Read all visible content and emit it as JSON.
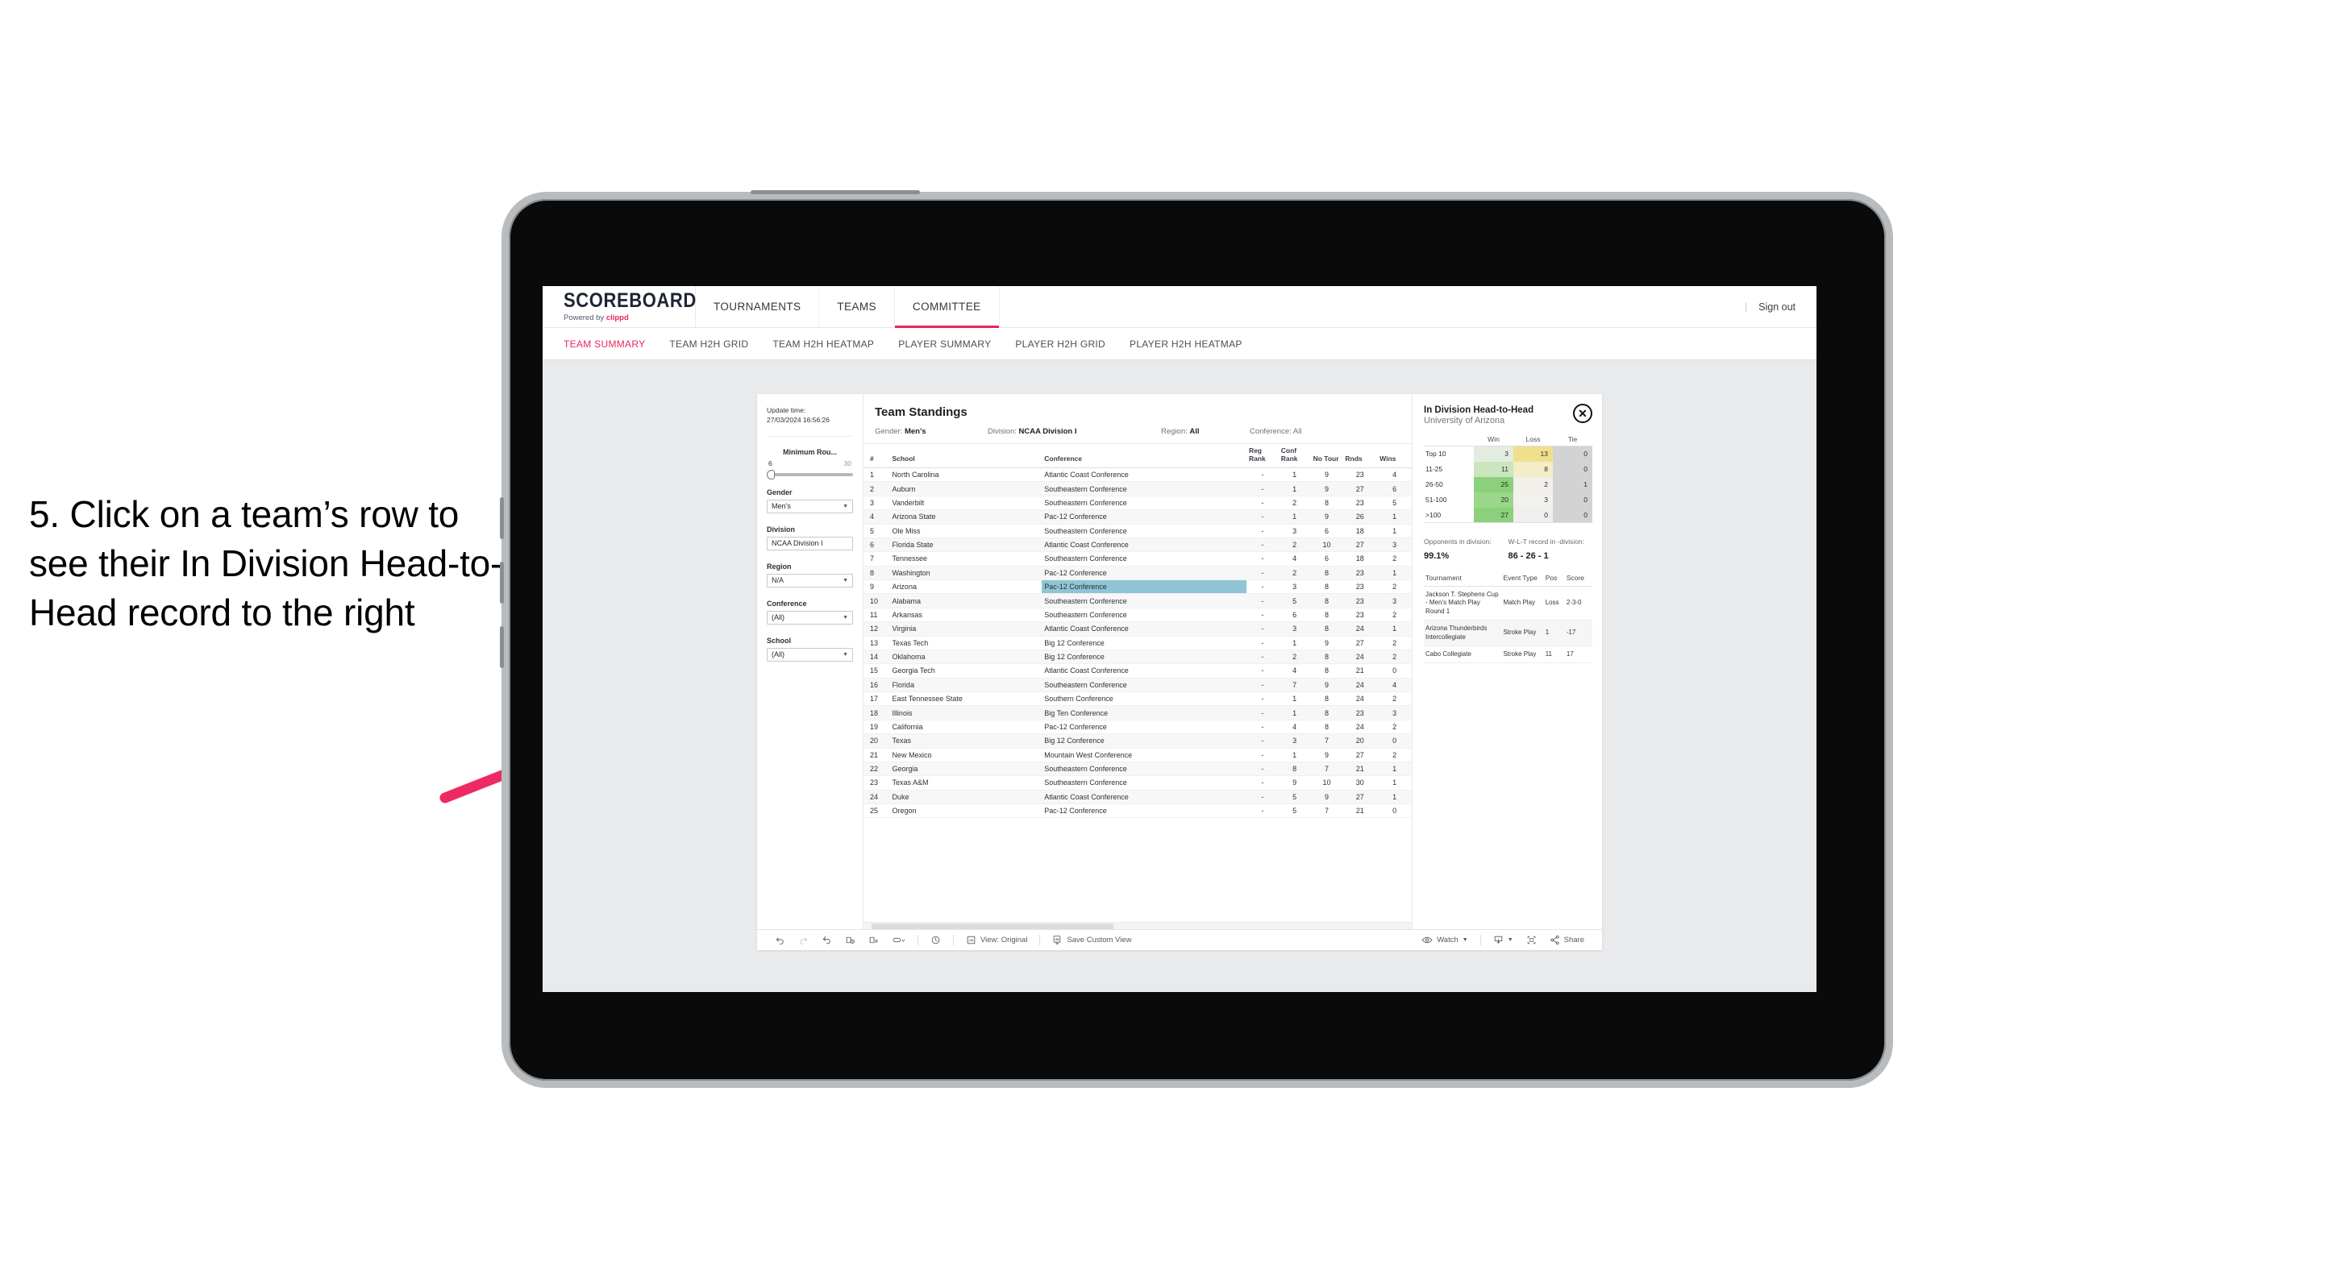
{
  "caption": "5. Click on a team’s row to see their In Division Head-to-Head record to the right",
  "accent": "#e8275b",
  "highlight": "#8fc5d4",
  "header": {
    "logo": "SCOREBOARD",
    "powered_prefix": "Powered by ",
    "powered_brand": "clippd",
    "nav": [
      {
        "label": "TOURNAMENTS",
        "active": false
      },
      {
        "label": "TEAMS",
        "active": false
      },
      {
        "label": "COMMITTEE",
        "active": true
      }
    ],
    "signout": "Sign out",
    "signout_divider": "|"
  },
  "subnav": [
    {
      "label": "TEAM SUMMARY",
      "active": true
    },
    {
      "label": "TEAM H2H GRID",
      "active": false
    },
    {
      "label": "TEAM H2H HEATMAP",
      "active": false
    },
    {
      "label": "PLAYER SUMMARY",
      "active": false
    },
    {
      "label": "PLAYER H2H GRID",
      "active": false
    },
    {
      "label": "PLAYER H2H HEATMAP",
      "active": false
    }
  ],
  "filters": {
    "update_label": "Update time:",
    "update_value": "27/03/2024 16:56:26",
    "slider": {
      "label": "Minimum Rou...",
      "min": "6",
      "max": "30"
    },
    "groups": [
      {
        "label": "Gender",
        "value": "Men’s"
      },
      {
        "label": "Division",
        "value": "NCAA Division I"
      },
      {
        "label": "Region",
        "value": "N/A"
      },
      {
        "label": "Conference",
        "value": "(All)"
      },
      {
        "label": "School",
        "value": "(All)"
      }
    ]
  },
  "standings": {
    "title": "Team Standings",
    "criteria": [
      {
        "label": "Gender: ",
        "value": "Men’s"
      },
      {
        "label": "Division: ",
        "value": "NCAA Division I"
      },
      {
        "label": "Region: ",
        "value": "All"
      },
      {
        "label": "Conference: ",
        "value": "All"
      }
    ],
    "columns": [
      "#",
      "School",
      "Conference",
      "Reg Rank",
      "Conf Rank",
      "No Tour",
      "Rnds",
      "Wins"
    ],
    "rows": [
      {
        "n": "1",
        "school": "North Carolina",
        "conf": "Atlantic Coast Conference",
        "reg": "-",
        "cr": "1",
        "nt": "9",
        "rnds": "23",
        "wins": "4"
      },
      {
        "n": "2",
        "school": "Auburn",
        "conf": "Southeastern Conference",
        "reg": "-",
        "cr": "1",
        "nt": "9",
        "rnds": "27",
        "wins": "6"
      },
      {
        "n": "3",
        "school": "Vanderbilt",
        "conf": "Southeastern Conference",
        "reg": "-",
        "cr": "2",
        "nt": "8",
        "rnds": "23",
        "wins": "5"
      },
      {
        "n": "4",
        "school": "Arizona State",
        "conf": "Pac-12 Conference",
        "reg": "-",
        "cr": "1",
        "nt": "9",
        "rnds": "26",
        "wins": "1"
      },
      {
        "n": "5",
        "school": "Ole Miss",
        "conf": "Southeastern Conference",
        "reg": "-",
        "cr": "3",
        "nt": "6",
        "rnds": "18",
        "wins": "1"
      },
      {
        "n": "6",
        "school": "Florida State",
        "conf": "Atlantic Coast Conference",
        "reg": "-",
        "cr": "2",
        "nt": "10",
        "rnds": "27",
        "wins": "3"
      },
      {
        "n": "7",
        "school": "Tennessee",
        "conf": "Southeastern Conference",
        "reg": "-",
        "cr": "4",
        "nt": "6",
        "rnds": "18",
        "wins": "2"
      },
      {
        "n": "8",
        "school": "Washington",
        "conf": "Pac-12 Conference",
        "reg": "-",
        "cr": "2",
        "nt": "8",
        "rnds": "23",
        "wins": "1"
      },
      {
        "n": "9",
        "school": "Arizona",
        "conf": "Pac-12 Conference",
        "reg": "-",
        "cr": "3",
        "nt": "8",
        "rnds": "23",
        "wins": "2",
        "selected": true
      },
      {
        "n": "10",
        "school": "Alabama",
        "conf": "Southeastern Conference",
        "reg": "-",
        "cr": "5",
        "nt": "8",
        "rnds": "23",
        "wins": "3"
      },
      {
        "n": "11",
        "school": "Arkansas",
        "conf": "Southeastern Conference",
        "reg": "-",
        "cr": "6",
        "nt": "8",
        "rnds": "23",
        "wins": "2"
      },
      {
        "n": "12",
        "school": "Virginia",
        "conf": "Atlantic Coast Conference",
        "reg": "-",
        "cr": "3",
        "nt": "8",
        "rnds": "24",
        "wins": "1"
      },
      {
        "n": "13",
        "school": "Texas Tech",
        "conf": "Big 12 Conference",
        "reg": "-",
        "cr": "1",
        "nt": "9",
        "rnds": "27",
        "wins": "2"
      },
      {
        "n": "14",
        "school": "Oklahoma",
        "conf": "Big 12 Conference",
        "reg": "-",
        "cr": "2",
        "nt": "8",
        "rnds": "24",
        "wins": "2"
      },
      {
        "n": "15",
        "school": "Georgia Tech",
        "conf": "Atlantic Coast Conference",
        "reg": "-",
        "cr": "4",
        "nt": "8",
        "rnds": "21",
        "wins": "0"
      },
      {
        "n": "16",
        "school": "Florida",
        "conf": "Southeastern Conference",
        "reg": "-",
        "cr": "7",
        "nt": "9",
        "rnds": "24",
        "wins": "4"
      },
      {
        "n": "17",
        "school": "East Tennessee State",
        "conf": "Southern Conference",
        "reg": "-",
        "cr": "1",
        "nt": "8",
        "rnds": "24",
        "wins": "2"
      },
      {
        "n": "18",
        "school": "Illinois",
        "conf": "Big Ten Conference",
        "reg": "-",
        "cr": "1",
        "nt": "8",
        "rnds": "23",
        "wins": "3"
      },
      {
        "n": "19",
        "school": "California",
        "conf": "Pac-12 Conference",
        "reg": "-",
        "cr": "4",
        "nt": "8",
        "rnds": "24",
        "wins": "2"
      },
      {
        "n": "20",
        "school": "Texas",
        "conf": "Big 12 Conference",
        "reg": "-",
        "cr": "3",
        "nt": "7",
        "rnds": "20",
        "wins": "0"
      },
      {
        "n": "21",
        "school": "New Mexico",
        "conf": "Mountain West Conference",
        "reg": "-",
        "cr": "1",
        "nt": "9",
        "rnds": "27",
        "wins": "2"
      },
      {
        "n": "22",
        "school": "Georgia",
        "conf": "Southeastern Conference",
        "reg": "-",
        "cr": "8",
        "nt": "7",
        "rnds": "21",
        "wins": "1"
      },
      {
        "n": "23",
        "school": "Texas A&M",
        "conf": "Southeastern Conference",
        "reg": "-",
        "cr": "9",
        "nt": "10",
        "rnds": "30",
        "wins": "1"
      },
      {
        "n": "24",
        "school": "Duke",
        "conf": "Atlantic Coast Conference",
        "reg": "-",
        "cr": "5",
        "nt": "9",
        "rnds": "27",
        "wins": "1"
      },
      {
        "n": "25",
        "school": "Oregon",
        "conf": "Pac-12 Conference",
        "reg": "-",
        "cr": "5",
        "nt": "7",
        "rnds": "21",
        "wins": "0"
      }
    ]
  },
  "h2h": {
    "title": "In Division Head-to-Head",
    "subtitle": "University of Arizona",
    "close_icon": "✕",
    "columns": [
      "",
      "Win",
      "Loss",
      "Tie"
    ],
    "rows": [
      {
        "band": "Top 10",
        "win": "3",
        "loss": "13",
        "tie": "0",
        "win_color": "#e2eddf",
        "loss_color": "#f0e08c",
        "tie_color": "#d3d3d3"
      },
      {
        "band": "11-25",
        "win": "11",
        "loss": "8",
        "tie": "0",
        "win_color": "#cbe5bf",
        "loss_color": "#f5ecc8",
        "tie_color": "#d3d3d3"
      },
      {
        "band": "26-50",
        "win": "25",
        "loss": "2",
        "tie": "1",
        "win_color": "#8bd07a",
        "loss_color": "#f2f0ea",
        "tie_color": "#d3d3d3"
      },
      {
        "band": "51-100",
        "win": "20",
        "loss": "3",
        "tie": "0",
        "win_color": "#9ad78a",
        "loss_color": "#f2f1ed",
        "tie_color": "#d3d3d3"
      },
      {
        "band": ">100",
        "win": "27",
        "loss": "0",
        "tie": "0",
        "win_color": "#8bd07a",
        "loss_color": "#efefef",
        "tie_color": "#d3d3d3"
      }
    ],
    "stats": [
      {
        "label": "Opponents in division:",
        "value": "99.1%"
      },
      {
        "label": "W-L-T record in -division:",
        "value": "86 - 26 - 1"
      }
    ],
    "tournaments": {
      "columns": [
        "Tournament",
        "Event Type",
        "Pos",
        "Score"
      ],
      "rows": [
        {
          "name": "Jackson T. Stephens Cup - Men’s Match Play Round 1",
          "type": "Match Play",
          "pos": "Loss",
          "score": "2-3-0"
        },
        {
          "name": "Arizona Thunderbirds Intercollegiate",
          "type": "Stroke Play",
          "pos": "1",
          "score": "-17"
        },
        {
          "name": "Cabo Collegiate",
          "type": "Stroke Play",
          "pos": "11",
          "score": "17"
        }
      ]
    }
  },
  "toolbar": {
    "left_icons": [
      "undo-icon",
      "redo-icon",
      "revert-icon",
      "refresh-data-icon",
      "pause-updates-icon",
      "shape-icon"
    ],
    "view_label": "View: Original",
    "save_label": "Save Custom View",
    "watch_label": "Watch",
    "share_label": "Share"
  }
}
